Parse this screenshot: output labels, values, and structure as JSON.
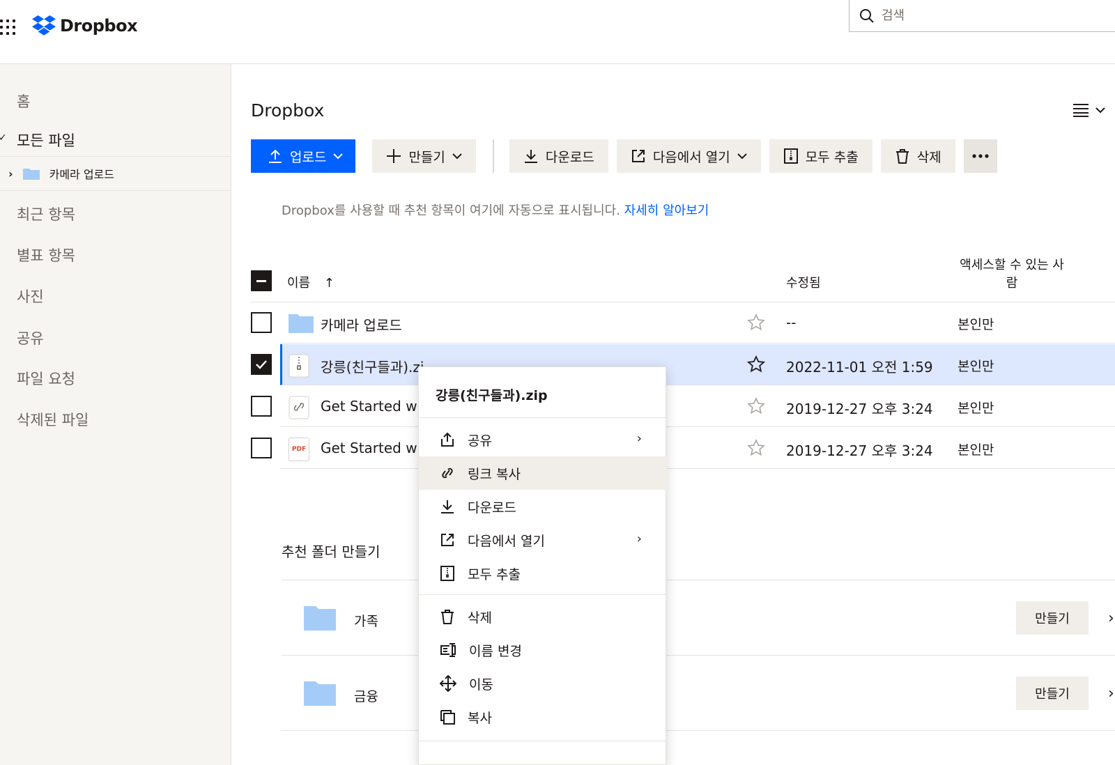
{
  "header": {
    "app_name": "Dropbox",
    "search_placeholder": "검색"
  },
  "sidebar": {
    "items": [
      {
        "label": "홈"
      },
      {
        "label": "모든 파일",
        "expanded": true
      },
      {
        "label": "최근 항목"
      },
      {
        "label": "별표 항목"
      },
      {
        "label": "사진"
      },
      {
        "label": "공유"
      },
      {
        "label": "파일 요청"
      },
      {
        "label": "삭제된 파일"
      }
    ],
    "subitem": {
      "label": "카메라 업로드"
    }
  },
  "main": {
    "title": "Dropbox",
    "toolbar": {
      "upload": "업로드",
      "create": "만들기",
      "download": "다운로드",
      "open_in": "다음에서 열기",
      "extract_all": "모두 추출",
      "delete": "삭제"
    },
    "hint": {
      "text": "Dropbox를 사용할 때 추천 항목이 여기에 자동으로 표시됩니다.",
      "link": "자세히 알아보기"
    },
    "table": {
      "columns": {
        "name": "이름",
        "modified": "수정됨",
        "access_line1": "액세스할 수 있는 사",
        "access_line2": "람"
      },
      "rows": [
        {
          "name": "카메라 업로드",
          "modified": "--",
          "access": "본인만",
          "type": "folder",
          "checked": false
        },
        {
          "name": "강릉(친구들과).zi",
          "modified": "2022-11-01 오전 1:59",
          "access": "본인만",
          "type": "zip",
          "checked": true
        },
        {
          "name": "Get Started w",
          "modified": "2019-12-27 오후 3:24",
          "access": "본인만",
          "type": "link",
          "checked": false
        },
        {
          "name": "Get Started w",
          "modified": "2019-12-27 오후 3:24",
          "access": "본인만",
          "type": "pdf",
          "checked": false
        }
      ],
      "pdf_badge": "PDF"
    },
    "suggested": {
      "title": "추천 폴더 만들기",
      "folders": [
        {
          "name": "가족",
          "button": "만들기"
        },
        {
          "name": "금융",
          "button": "만들기"
        }
      ]
    }
  },
  "context_menu": {
    "title": "강릉(친구들과).zip",
    "items": [
      {
        "label": "공유",
        "icon": "share-icon",
        "submenu": true
      },
      {
        "label": "링크 복사",
        "icon": "link-icon",
        "highlighted": true
      },
      {
        "label": "다운로드",
        "icon": "download-icon"
      },
      {
        "label": "다음에서 열기",
        "icon": "open-in-icon",
        "submenu": true
      },
      {
        "label": "모두 추출",
        "icon": "extract-icon"
      },
      {
        "label": "삭제",
        "icon": "trash-icon"
      },
      {
        "label": "이름 변경",
        "icon": "rename-icon"
      },
      {
        "label": "이동",
        "icon": "move-icon"
      },
      {
        "label": "복사",
        "icon": "copy-icon"
      }
    ]
  },
  "colors": {
    "accent": "#0061fe",
    "selected_row": "#dde7fe",
    "folder": "#a5ccf7",
    "sidebar_bg": "#f7f5f2"
  }
}
